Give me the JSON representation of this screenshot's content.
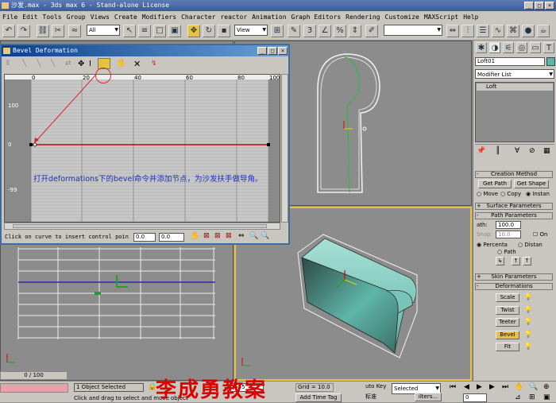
{
  "app": {
    "title": "沙发.max - 3ds max 6 - Stand-alone License"
  },
  "menu": [
    "File",
    "Edit",
    "Tools",
    "Group",
    "Views",
    "Create",
    "Modifiers",
    "Character",
    "reactor",
    "Animation",
    "Graph Editors",
    "Rendering",
    "Customize",
    "MAXScript",
    "Help"
  ],
  "toolbar": {
    "selection_filter": "All",
    "ref_coord": "View",
    "named_selection": ""
  },
  "bevel_window": {
    "title": "Bevel Deformation",
    "ruler": [
      "0",
      "20",
      "40",
      "60",
      "80",
      "100"
    ],
    "y_labels": [
      "100",
      "0",
      "-99"
    ],
    "annotation": "打开deformations下的bevel命令并添加节点，为沙发扶手做导角。",
    "status_hint": "Click on curve to insert control poin",
    "field_a": "0.0",
    "field_b": "0.0"
  },
  "command_panel": {
    "object_name": "Loft01",
    "modifier_list": "Modifier List",
    "stack_item": "Loft",
    "creation_method": {
      "title": "Creation Method",
      "get_path": "Get Path",
      "get_shape": "Get Shape",
      "options": [
        "Move",
        "Copy",
        "Instan"
      ]
    },
    "surface_parameters": "Surface Parameters",
    "path_parameters": {
      "title": "Path Parameters",
      "path_label": "ath:",
      "path_value": "100.0",
      "snap_label": "Snap:",
      "snap_value": "10.0",
      "on_label": "On",
      "percentage": "Percenta",
      "distance": "Distan",
      "path_step": "Path"
    },
    "skin_parameters": "Skin Parameters",
    "deformations": {
      "title": "Deformations",
      "buttons": [
        "Scale",
        "Twist",
        "Teeter",
        "Bevel",
        "Fit"
      ]
    }
  },
  "status": {
    "time_slider": "0 / 100",
    "selected": "1 Object Selected",
    "prompt": "Click and drag to select and move object",
    "y_field": ".555",
    "grid": "Grid = 10.0",
    "add_time_tag": "Add Time Tag",
    "auto_key": "uto Key",
    "key_mode": "Selected",
    "standard": "标准",
    "filters": "ilters...",
    "frame": "0",
    "watermark": "李成勇教案"
  },
  "colors": {
    "title_blue": "#3a5a9c",
    "ui_gray": "#c9c6c0",
    "viewport_gray": "#8c8c8c",
    "active_border": "#e8c23a",
    "sofa_teal": "#5fb5a8",
    "curve_red": "#cc0000",
    "annotation_blue": "#1f2fb5",
    "watermark_red": "#dd0000"
  }
}
